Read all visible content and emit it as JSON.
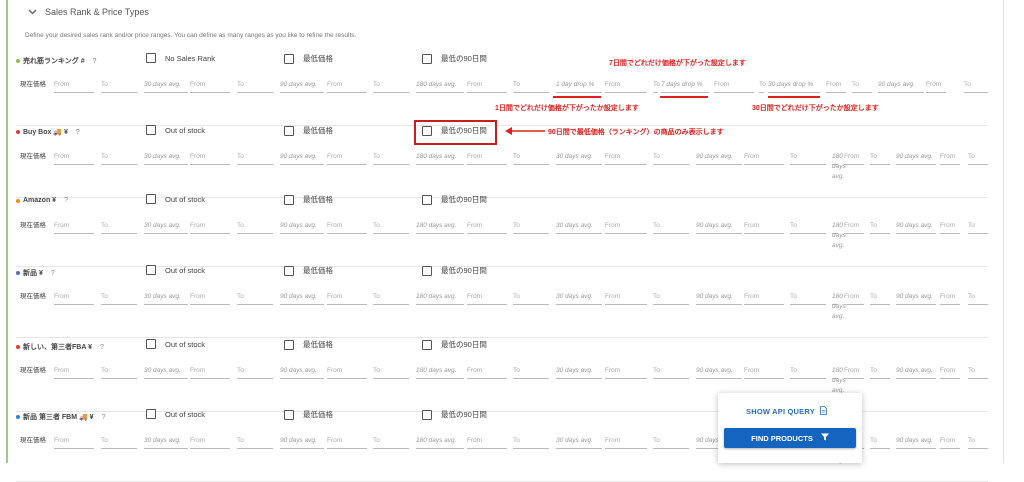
{
  "header": {
    "title": "Sales Rank & Price Types"
  },
  "description": "Define your desired sales rank and/or price ranges. You can define as many ranges as you like to refine the results.",
  "field_labels": {
    "first": "現在価格",
    "from": "From",
    "to": "To",
    "avg30": "30 days avg.",
    "avg90": "90 days avg.",
    "avg180": "180 days avg.",
    "drop1": "1 day drop %",
    "drop7": "7 days drop %",
    "drop30": "30 days drop %"
  },
  "sections": [
    {
      "label": "売れ筋ランキング #",
      "help": "?",
      "dot": "#8bc34a",
      "cb1": "No Sales Rank",
      "cb2": "最低価格",
      "cb3": "最低の90日間",
      "drops": true
    },
    {
      "label": "Buy Box 🚚 ¥",
      "help": "?",
      "dot": "#e53935",
      "cb1": "Out of stock",
      "cb2": "最低価格",
      "cb3": "最低の90日間",
      "drops": false
    },
    {
      "label": "Amazon ¥",
      "help": "?",
      "dot": "#fb8c00",
      "cb1": "Out of stock",
      "cb2": "最低価格",
      "cb3": "最低の90日間",
      "drops": false
    },
    {
      "label": "新品 ¥",
      "help": "?",
      "dot": "#5c6bc0",
      "cb1": "Out of stock",
      "cb2": "最低価格",
      "cb3": "最低の90日間",
      "drops": false
    },
    {
      "label": "新しい、第三者FBA ¥",
      "help": "?",
      "dot": "#e53935",
      "cb1": "Out of stock",
      "cb2": "最低価格",
      "cb3": "最低の90日間",
      "drops": false
    },
    {
      "label": "新品 第三者 FBM 🚚 ¥",
      "help": "?",
      "dot": "#1e88e5",
      "cb1": "Out of stock",
      "cb2": "最低価格",
      "cb3": "最低の90日間",
      "drops": false
    }
  ],
  "annotations": {
    "seven_day": "7日間でどれだけ価格が下がった設定します",
    "one_day": "1日間でどれだけ価格が下がったか設定します",
    "thirty_day": "30日間でどれだけ下がったか設定します",
    "ninety_low": "90日間で最低価格（ランキング）の商品のみ表示します"
  },
  "buttons": {
    "show_api": "SHOW API QUERY",
    "find": "FIND PRODUCTS"
  },
  "colors": {
    "accent": "#1565c0",
    "annotation": "#e02020",
    "frame_left": "#9bc98a"
  },
  "icons": {
    "header": "chevron-down-icon",
    "api": "document-icon",
    "find": "filter-icon"
  }
}
